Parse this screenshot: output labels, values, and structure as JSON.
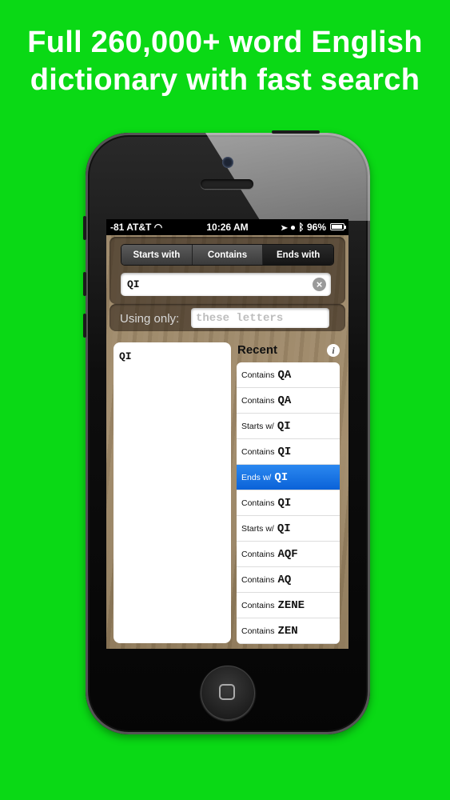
{
  "headline": {
    "line1": "Full 260,000+ word English",
    "line2": "dictionary with fast search"
  },
  "status_bar": {
    "carrier": "-81 AT&T",
    "time": "10:26 AM",
    "battery": "96%",
    "battery_level": 0.96
  },
  "search_mode": {
    "options": [
      "Starts with",
      "Contains",
      "Ends with"
    ],
    "selected": "Ends with"
  },
  "search": {
    "value": "QI"
  },
  "filter": {
    "label": "Using only:",
    "placeholder": "these letters"
  },
  "results": [
    "QI"
  ],
  "recent": {
    "title": "Recent",
    "items": [
      {
        "prefix": "Contains",
        "term": "QA",
        "selected": false
      },
      {
        "prefix": "Contains",
        "term": "QA",
        "selected": false
      },
      {
        "prefix": "Starts w/",
        "term": "QI",
        "selected": false
      },
      {
        "prefix": "Contains",
        "term": "QI",
        "selected": false
      },
      {
        "prefix": "Ends w/",
        "term": "QI",
        "selected": true
      },
      {
        "prefix": "Contains",
        "term": "QI",
        "selected": false
      },
      {
        "prefix": "Starts w/",
        "term": "QI",
        "selected": false
      },
      {
        "prefix": "Contains",
        "term": "AQF",
        "selected": false
      },
      {
        "prefix": "Contains",
        "term": "AQ",
        "selected": false
      },
      {
        "prefix": "Contains",
        "term": "ZENE",
        "selected": false
      },
      {
        "prefix": "Contains",
        "term": "ZEN",
        "selected": false
      }
    ]
  },
  "colors": {
    "background": "#0ad915",
    "selection": "#0a62d8"
  }
}
